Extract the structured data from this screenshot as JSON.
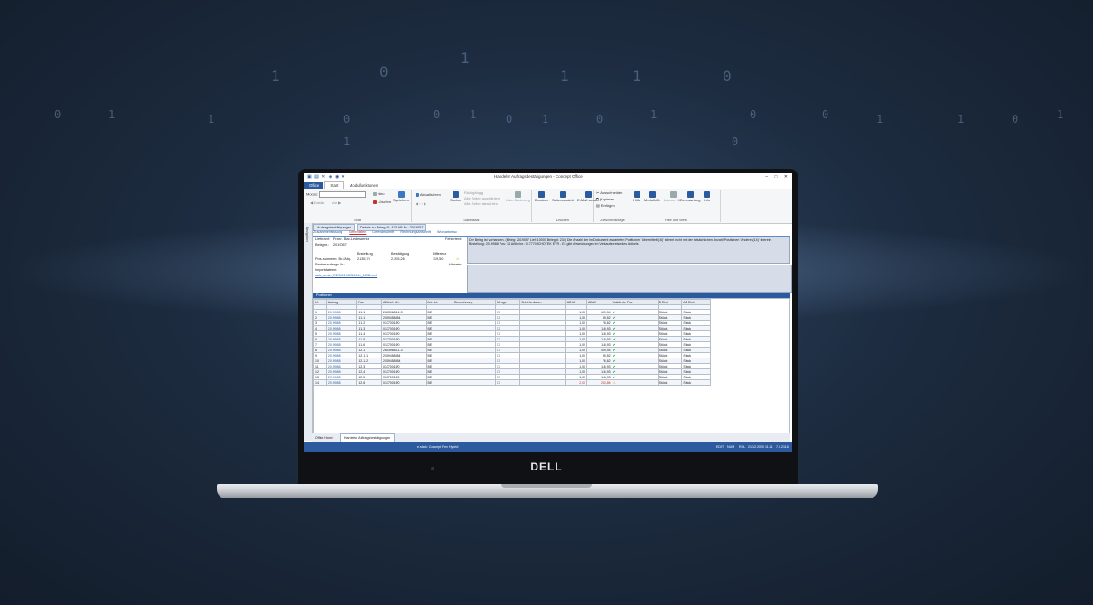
{
  "app": {
    "window_title": "Handelsr Auftragsbestätigungen - Concept Office",
    "tabs": [
      "Office",
      "Start",
      "Modulfunktionen"
    ],
    "active_tab": "Start"
  },
  "ribbon": {
    "start": {
      "mode_label": "Modus:",
      "new_label": "Neu",
      "delete_label": "Löschen",
      "save_label": "Speichern",
      "zurueck_label": "Zurück",
      "vor_label": "Vor",
      "group": "Start"
    },
    "datensatz": {
      "refresh_label": "Aktualisieren",
      "search_label": "Suchen",
      "rueckgaengig": "Rückgängig",
      "select_all": "Alle Zeilen auswählen",
      "deselect_all": "Alle Zeilen abwählen",
      "list_label": "Liste Änderung",
      "group": "Datensatz"
    },
    "drucken": {
      "print_label": "Drucken",
      "preview_label": "Seitenansicht",
      "email_label": "E-Mail senden",
      "group": "Drucken"
    },
    "zwischenablage": {
      "cut": "Ausschneiden",
      "copy": "Kopieren",
      "paste": "Einfügen",
      "group": "Zwischenablage"
    },
    "hilfe": {
      "help": "Hilfe",
      "modulhilfe": "Modulhilfe",
      "interne_hilfe": "Interne Hilfe",
      "fernwartung": "Fernwartung",
      "info": "Info",
      "group": "Hilfe und Web"
    }
  },
  "sidebar": {
    "label": "Navigation"
  },
  "breadcrumbs": [
    "Auftragsbestätigungen",
    "Details zu Beleg ID: 476 AB Nr.: 2019057"
  ],
  "subtabs": [
    "Zusammenfassung",
    "Lieferdaten",
    "Lieferanschrift",
    "Rechnungsanschrift",
    "Workarbeitsc"
  ],
  "info": {
    "lieferant_label": "Lieferant:",
    "lieferant_value": "Franz. Bad-Lederwerke",
    "belegnr_label": "Belegnr.:",
    "belegnr_value": "2019057",
    "fehlertext_label": "Fehlertext:",
    "bestellung_label": "Bestellung",
    "bestaetigung_label": "Bestätigung",
    "differenz_label": "Differenz",
    "pos_summe_label": "Pos.-summen: Bp./Abp.",
    "bestellung_value": "2.135,76",
    "bestaetigung_value": "2.255,26",
    "differenz_value": "119,50",
    "hinweis_label": "Hinweis:",
    "partnerauftrag_label": "Partnerauftrags-Nr.:",
    "importdateien_label": "Importdateien:",
    "import_file": "sale_order_RE300196250914_1234.xml"
  },
  "message": "Der Beleg ist vorhanden. (Beleg: 2019057 Lief: 10000 Belegid: 234) Die Anzahl der im Dokument erwarteten Positionen 'übermittelt(16)' stimmt nicht mit der tatsächlichen Anzahl Positionen 'Anderes(14)' überein. Bestellung: 2019988 Pos: 14 Artikelnr.: 017770 ICHOTEK EYR - Es gibt Abweichungen im Verkaufspreise des Artikels",
  "positions": {
    "title": "Positionen",
    "headers": [
      "Lf.",
      "Auftrag",
      "Pos.",
      "A. Bestellung",
      "AB Lief. Art.",
      "Art. Art.",
      "Bezeichnung",
      "Menge",
      "B-Lieferdatum",
      "AB-Lieferdatum",
      "AB-Lieferdatum",
      "AB M",
      "AB W",
      "Validierte Pos.",
      "B Einh",
      "AB Einh"
    ],
    "rows": [
      [
        "1",
        "2019988",
        "1.1.1",
        "26039681-1.3",
        "BE",
        "",
        "1,00",
        "409,94",
        "Stück",
        "Stück",
        "ok"
      ],
      [
        "2",
        "2019988",
        "1.1.1",
        "2019458454",
        "BE",
        "",
        "1,00",
        "89,52",
        "Stück",
        "Stück",
        "ok"
      ],
      [
        "3",
        "2019988",
        "1.1.2",
        "01770016/0",
        "BE",
        "",
        "1,00",
        "76,62",
        "Stück",
        "Stück",
        "ok"
      ],
      [
        "4",
        "2019988",
        "1.1.3",
        "01770016/0",
        "BE",
        "",
        "1,00",
        "116,93",
        "Stück",
        "Stück",
        "ok"
      ],
      [
        "5",
        "2019988",
        "1.1.4",
        "01770016/0",
        "BE",
        "",
        "1,00",
        "116,93",
        "Stück",
        "Stück",
        "ok"
      ],
      [
        "6",
        "2019988",
        "1.1.5",
        "01770016/0",
        "BE",
        "",
        "1,00",
        "116,93",
        "Stück",
        "Stück",
        "ok"
      ],
      [
        "7",
        "2019988",
        "1.1.6",
        "01770016/0",
        "BE",
        "",
        "1,00",
        "116,93",
        "Stück",
        "Stück",
        "ok"
      ],
      [
        "8",
        "2019988",
        "1.2.1",
        "26039681-1.3",
        "BE",
        "",
        "1,00",
        "409,94",
        "Stück",
        "Stück",
        "ok"
      ],
      [
        "9",
        "2019988",
        "1.2.1.1",
        "2019458454",
        "BE",
        "",
        "1,00",
        "89,52",
        "Stück",
        "Stück",
        "ok"
      ],
      [
        "10",
        "2019988",
        "1.2.1.2",
        "2019458454",
        "BE",
        "",
        "1,00",
        "76,62",
        "Stück",
        "Stück",
        "ok"
      ],
      [
        "11",
        "2019988",
        "1.2.3",
        "01770016/0",
        "BE",
        "",
        "1,00",
        "116,93",
        "Stück",
        "Stück",
        "ok"
      ],
      [
        "12",
        "2019988",
        "1.2.4",
        "01770016/0",
        "BE",
        "",
        "1,00",
        "116,93",
        "Stück",
        "Stück",
        "ok"
      ],
      [
        "13",
        "2019988",
        "1.2.5",
        "01770016/0",
        "BE",
        "",
        "1,00",
        "116,93",
        "Stück",
        "Stück",
        "ok"
      ],
      [
        "14",
        "2019988",
        "1.2.6",
        "01770016/0",
        "BE",
        "",
        "2,00",
        "233,86",
        "Stück",
        "Stück",
        "warn"
      ]
    ]
  },
  "bottom_tabs": [
    "Office Home",
    "Handelsr Auftragsbestätigungen"
  ],
  "status": {
    "left": "e.stark: Concept Flex Hybrid",
    "mode": "EDIT",
    "num": "NUM",
    "rol": "ROL",
    "datetime": "21.12.2020 11:21",
    "version": "7.0.2118"
  },
  "laptop_brand": "DELL",
  "colors": {
    "accent": "#2d5a9e",
    "ok": "#1a9c2e",
    "warn": "#d59b00",
    "error": "#c8312b"
  }
}
